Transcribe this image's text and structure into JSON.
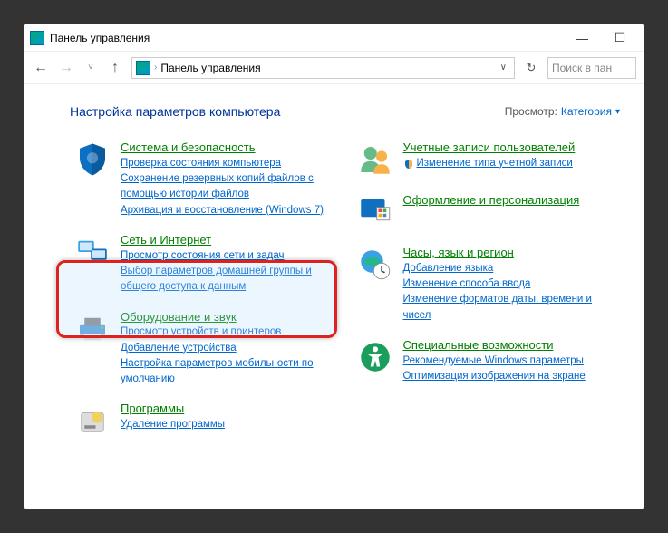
{
  "window": {
    "title": "Панель управления"
  },
  "address": {
    "text": "Панель управления"
  },
  "search": {
    "placeholder": "Поиск в пан"
  },
  "heading": "Настройка параметров компьютера",
  "viewby": {
    "label": "Просмотр:",
    "value": "Категория"
  },
  "left": [
    {
      "title": "Система и безопасность",
      "links": [
        "Проверка состояния компьютера",
        "Сохранение резервных копий файлов с помощью истории файлов",
        "Архивация и восстановление (Windows 7)"
      ]
    },
    {
      "title": "Сеть и Интернет",
      "links": [
        "Просмотр состояния сети и задач",
        "Выбор параметров домашней группы и общего доступа к данным"
      ]
    },
    {
      "title": "Оборудование и звук",
      "links": [
        "Просмотр устройств и принтеров",
        "Добавление устройства",
        "Настройка параметров мобильности по умолчанию"
      ]
    },
    {
      "title": "Программы",
      "links": [
        "Удаление программы"
      ]
    }
  ],
  "right": [
    {
      "title": "Учетные записи пользователей",
      "links": [
        "Изменение типа учетной записи"
      ]
    },
    {
      "title": "Оформление и персонализация",
      "links": []
    },
    {
      "title": "Часы, язык и регион",
      "links": [
        "Добавление языка",
        "Изменение способа ввода",
        "Изменение форматов даты, времени и чисел"
      ]
    },
    {
      "title": "Специальные возможности",
      "links": [
        "Рекомендуемые Windows параметры",
        "Оптимизация изображения на экране"
      ]
    }
  ]
}
